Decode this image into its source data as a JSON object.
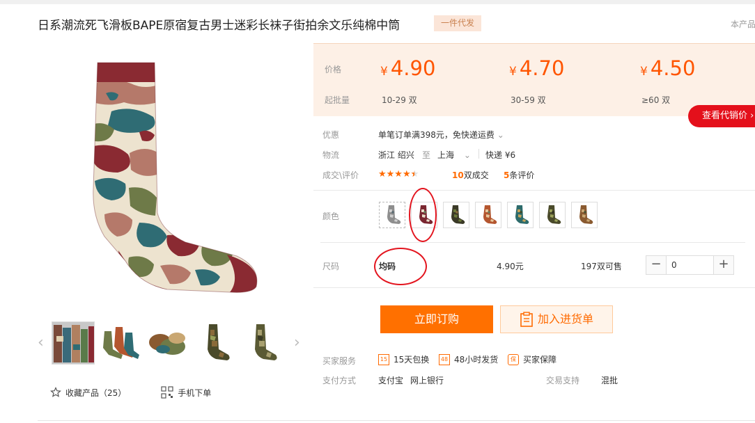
{
  "product": {
    "title": "日系潮流死飞滑板BAPE原宿复古男士迷彩长袜子街拍余文乐纯棉中筒",
    "tag": "一件代发",
    "corner_text": "本产品"
  },
  "price_box": {
    "price_label": "价格",
    "qty_label": "起批量",
    "tiers": [
      {
        "currency": "¥",
        "price": "4.90",
        "qty": "10-29 双"
      },
      {
        "currency": "¥",
        "price": "4.70",
        "qty": "30-59 双"
      },
      {
        "currency": "¥",
        "price": "4.50",
        "qty": "≥60 双"
      }
    ],
    "dropship_button": "查看代销价"
  },
  "details": {
    "discount_label": "优惠",
    "discount_value": "单笔订单满398元，免快递运费",
    "logistics_label": "物流",
    "origin": "浙江 绍兴",
    "to": "至",
    "destination": "上海",
    "shipping": "快递 ¥6",
    "deal_label": "成交\\评价",
    "deals_count": "10",
    "deals_text": "双成交",
    "reviews_count": "5",
    "reviews_text": "条评价",
    "rating": 4.5
  },
  "color": {
    "label": "颜色",
    "swatches": [
      {
        "name": "grey",
        "sock": "#8e8e8e",
        "accent": "#cfcfcf",
        "pattern": "#5a6b72"
      },
      {
        "name": "burgundy",
        "sock": "#7a2630",
        "accent": "#e8ddc8",
        "pattern": "#6b7c5a"
      },
      {
        "name": "green-dark",
        "sock": "#3b3a27",
        "accent": "#6c7a3a",
        "pattern": "#8a6a3a"
      },
      {
        "name": "orange",
        "sock": "#b4562f",
        "accent": "#e6c79c",
        "pattern": "#6b7b5a"
      },
      {
        "name": "teal",
        "sock": "#2d6b6b",
        "accent": "#c4a35a",
        "pattern": "#3d4a2a"
      },
      {
        "name": "olive",
        "sock": "#4a4a2a",
        "accent": "#9aa05a",
        "pattern": "#2e2e20"
      },
      {
        "name": "khaki",
        "sock": "#8a5a30",
        "accent": "#c9a772",
        "pattern": "#4a5030"
      }
    ]
  },
  "size": {
    "label": "尺码",
    "value": "均码",
    "price": "4.90元",
    "stock": "197双可售",
    "quantity": "0",
    "minus": "−",
    "plus": "+"
  },
  "buttons": {
    "buy": "立即订购",
    "add_to_list": "加入进货单"
  },
  "services": {
    "label": "买家服务",
    "items": [
      {
        "icon": "15",
        "text": "15天包换"
      },
      {
        "icon": "48",
        "text": "48小时发货"
      },
      {
        "icon": "保",
        "text": "买家保障"
      }
    ]
  },
  "payment": {
    "label": "支付方式",
    "methods": [
      "支付宝",
      "网上银行"
    ],
    "trade_label": "交易支持",
    "trade_value": "混批"
  },
  "left_actions": {
    "favorite": "收藏产品（25）",
    "mobile": "手机下单"
  },
  "colors": {
    "accent": "#ff5500",
    "button_orange": "#ff7000",
    "red": "#e4101b",
    "sock_main": "#8a2a32"
  }
}
